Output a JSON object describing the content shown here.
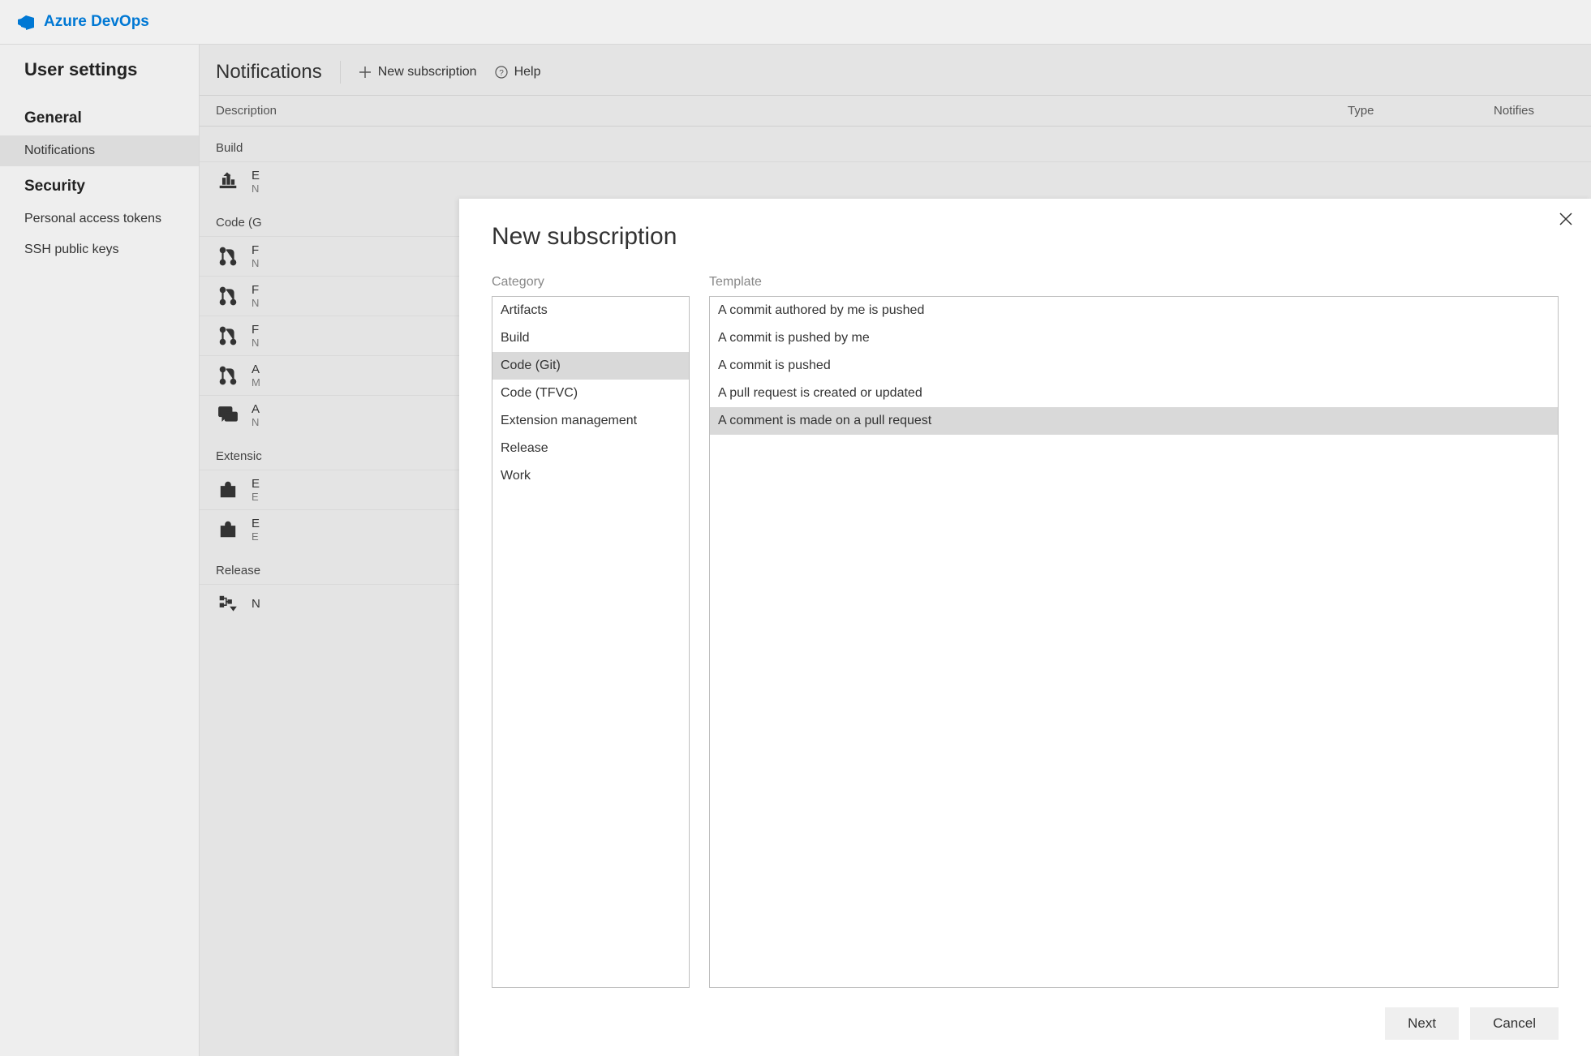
{
  "header": {
    "product": "Azure DevOps"
  },
  "sidebar": {
    "title": "User settings",
    "groups": [
      {
        "label": "General",
        "items": [
          {
            "label": "Notifications",
            "selected": true
          }
        ]
      },
      {
        "label": "Security",
        "items": [
          {
            "label": "Personal access tokens"
          },
          {
            "label": "SSH public keys"
          }
        ]
      }
    ]
  },
  "page": {
    "title": "Notifications",
    "actions": {
      "new": "New subscription",
      "help": "Help"
    },
    "columns": {
      "description": "Description",
      "type": "Type",
      "notifies": "Notifies"
    },
    "groups": [
      {
        "label": "Build",
        "rows": [
          {
            "icon": "build",
            "titleInitial": "E",
            "subInitial": "N"
          }
        ]
      },
      {
        "label": "Code (G",
        "rows": [
          {
            "icon": "pr",
            "titleInitial": "F",
            "subInitial": "N"
          },
          {
            "icon": "pr",
            "titleInitial": "F",
            "subInitial": "N"
          },
          {
            "icon": "pr",
            "titleInitial": "F",
            "subInitial": "N"
          },
          {
            "icon": "pr",
            "titleInitial": "A",
            "subInitial": "M"
          },
          {
            "icon": "chat",
            "titleInitial": "A",
            "subInitial": "N"
          }
        ]
      },
      {
        "label": "Extensic",
        "rows": [
          {
            "icon": "bag",
            "titleInitial": "E",
            "subInitial": "E"
          },
          {
            "icon": "bag",
            "titleInitial": "E",
            "subInitial": "E"
          }
        ]
      },
      {
        "label": "Release",
        "rows": [
          {
            "icon": "release",
            "titleInitial": "N",
            "subInitial": ""
          }
        ]
      }
    ]
  },
  "modal": {
    "title": "New subscription",
    "labels": {
      "category": "Category",
      "template": "Template"
    },
    "categories": [
      "Artifacts",
      "Build",
      "Code (Git)",
      "Code (TFVC)",
      "Extension management",
      "Release",
      "Work"
    ],
    "selectedCategoryIndex": 2,
    "templates": [
      "A commit authored by me is pushed",
      "A commit is pushed by me",
      "A commit is pushed",
      "A pull request is created or updated",
      "A comment is made on a pull request"
    ],
    "selectedTemplateIndex": 4,
    "buttons": {
      "next": "Next",
      "cancel": "Cancel"
    }
  }
}
